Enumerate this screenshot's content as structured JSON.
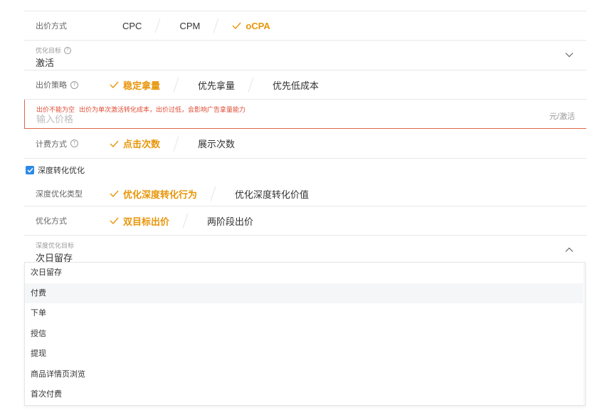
{
  "bid_method": {
    "label": "出价方式",
    "options": [
      {
        "label": "CPC",
        "selected": false
      },
      {
        "label": "CPM",
        "selected": false
      },
      {
        "label": "oCPA",
        "selected": true
      }
    ]
  },
  "optimization_goal": {
    "label": "优化目标",
    "value": "激活"
  },
  "bid_strategy": {
    "label": "出价策略",
    "options": [
      {
        "label": "稳定拿量",
        "selected": true
      },
      {
        "label": "优先拿量",
        "selected": false
      },
      {
        "label": "优先低成本",
        "selected": false
      }
    ]
  },
  "price": {
    "error": "出价不能为空",
    "hint": "出价为单次激活转化成本，出价过低，会影响广告拿量能力",
    "placeholder": "输入价格",
    "unit": "元/激活"
  },
  "billing_method": {
    "label": "计费方式",
    "options": [
      {
        "label": "点击次数",
        "selected": true
      },
      {
        "label": "展示次数",
        "selected": false
      }
    ]
  },
  "deep_conversion": {
    "checkbox_label": "深度转化优化",
    "checked": true
  },
  "deep_type": {
    "label": "深度优化类型",
    "options": [
      {
        "label": "优化深度转化行为",
        "selected": true
      },
      {
        "label": "优化深度转化价值",
        "selected": false
      }
    ]
  },
  "optimize_method": {
    "label": "优化方式",
    "options": [
      {
        "label": "双目标出价",
        "selected": true
      },
      {
        "label": "两阶段出价",
        "selected": false
      }
    ]
  },
  "deep_goal": {
    "label": "深度优化目标",
    "value": "次日留存"
  },
  "dropdown": {
    "items": [
      "次日留存",
      "付费",
      "下单",
      "授信",
      "提现",
      "商品详情页浏览",
      "首次付费"
    ],
    "hovered_index": 1
  },
  "colors": {
    "accent": "#e8960a",
    "error": "#e04a32",
    "checkbox": "#2b8ae6",
    "border": "#e8e8e8"
  },
  "icons": {
    "check": "check-icon",
    "help": "question-circle-icon",
    "chevron_down": "chevron-down-icon",
    "chevron_up": "chevron-up-icon"
  }
}
